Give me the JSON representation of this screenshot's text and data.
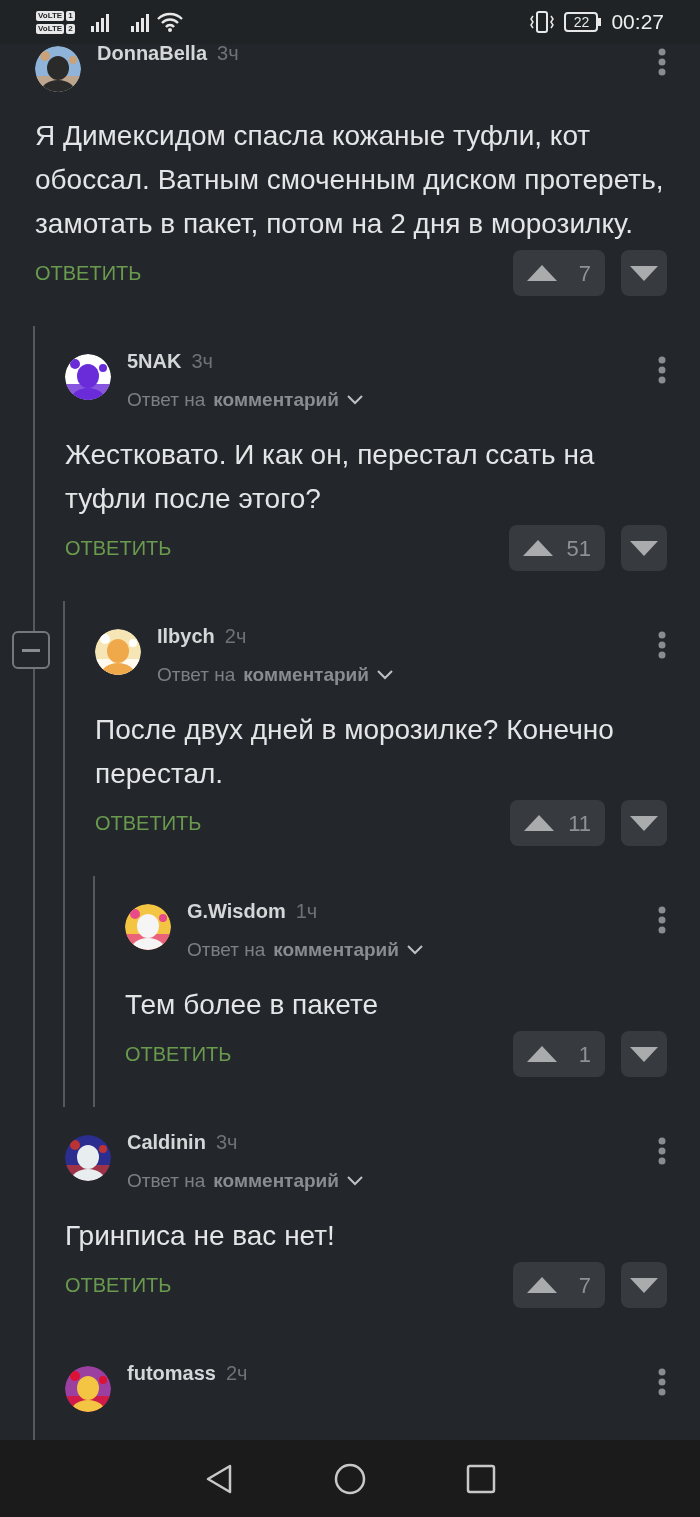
{
  "status_bar": {
    "sims": [
      {
        "label": "VoLTE",
        "number": "1"
      },
      {
        "label": "VoLTE",
        "number": "2"
      }
    ],
    "battery": "22",
    "time": "00:27"
  },
  "comments": [
    {
      "author": "DonnaBella",
      "time": "3ч",
      "text": "Я Димексидом спасла кожаные туфли, кот обоссал. Ватным смоченным диском протереть, замотать в пакет, потом на 2 дня в морозилку.",
      "reply_label": "ОТВЕТИТЬ",
      "votes": "7",
      "children": [
        {
          "author": "5NAK",
          "time": "3ч",
          "reply_to": {
            "prefix": "Ответ на",
            "target": "комментарий"
          },
          "text": "Жестковато. И как он, перестал ссать на туфли после этого?",
          "reply_label": "ОТВЕТИТЬ",
          "votes": "51",
          "children": [
            {
              "author": "Ilbych",
              "time": "2ч",
              "collapse_control": true,
              "reply_to": {
                "prefix": "Ответ на",
                "target": "комментарий"
              },
              "text": "После двух дней в морозилке? Конечно перестал.",
              "reply_label": "ОТВЕТИТЬ",
              "votes": "11",
              "children": [
                {
                  "author": "G.Wisdom",
                  "time": "1ч",
                  "reply_to": {
                    "prefix": "Ответ на",
                    "target": "комментарий"
                  },
                  "text": "Тем более в пакете",
                  "reply_label": "ОТВЕТИТЬ",
                  "votes": "1"
                }
              ]
            }
          ]
        },
        {
          "author": "Caldinin",
          "time": "3ч",
          "reply_to": {
            "prefix": "Ответ на",
            "target": "комментарий"
          },
          "text": "Гринписа не вас нет!",
          "reply_label": "ОТВЕТИТЬ",
          "votes": "7"
        },
        {
          "author": "futomass",
          "time": "2ч"
        }
      ]
    }
  ]
}
